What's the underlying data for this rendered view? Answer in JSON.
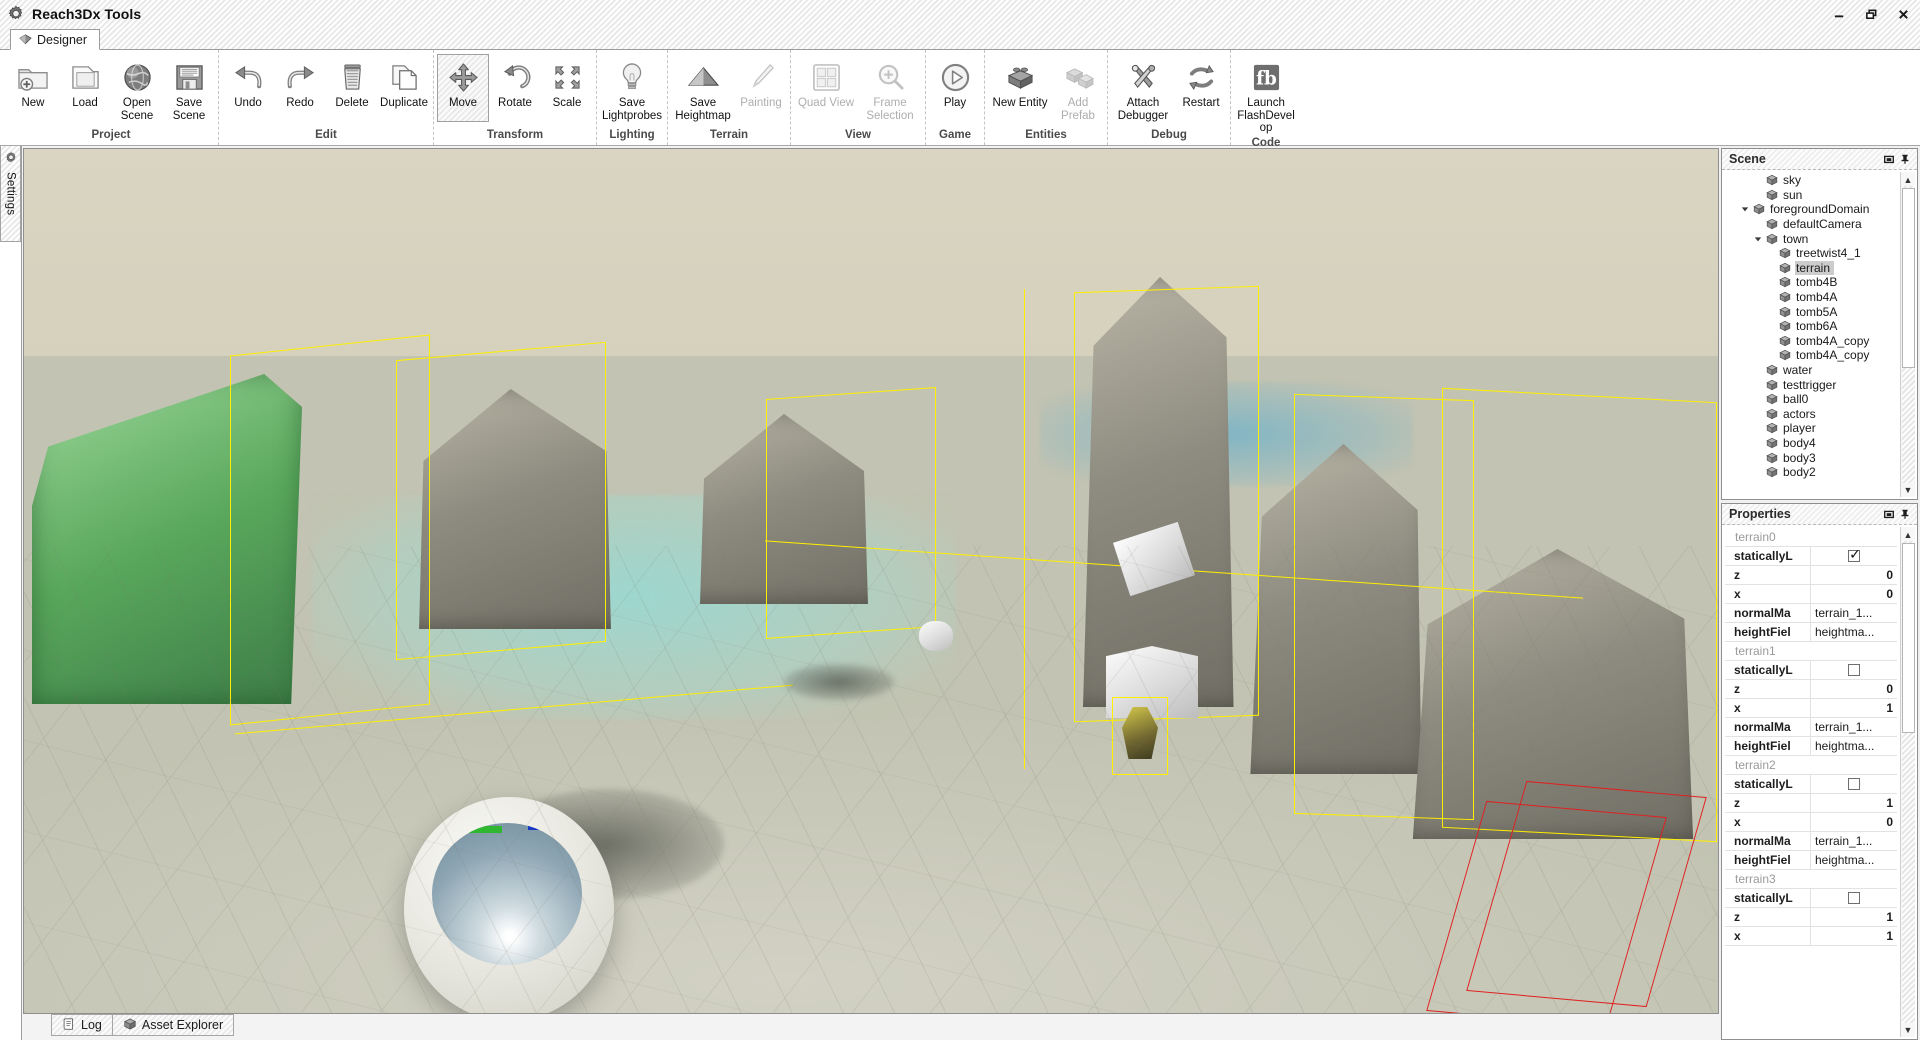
{
  "window": {
    "title": "Reach3Dx Tools",
    "app_icon": "gear-icon",
    "controls": {
      "minimize": "–",
      "restore": "❐",
      "close": "✕"
    }
  },
  "ribbon": {
    "tabs": [
      {
        "label": "Designer",
        "icon": "diamond-icon",
        "active": true
      }
    ],
    "groups": [
      {
        "label": "Project",
        "buttons": [
          {
            "label": "New",
            "icon": "new-folder-icon",
            "enabled": true,
            "active": false
          },
          {
            "label": "Load",
            "icon": "open-folder-icon",
            "enabled": true,
            "active": false
          },
          {
            "label": "Open Scene",
            "icon": "globe-icon",
            "enabled": true,
            "active": false
          },
          {
            "label": "Save Scene",
            "icon": "floppy-icon",
            "enabled": true,
            "active": false
          }
        ]
      },
      {
        "label": "Edit",
        "buttons": [
          {
            "label": "Undo",
            "icon": "undo-arrow-icon",
            "enabled": true,
            "active": false
          },
          {
            "label": "Redo",
            "icon": "redo-arrow-icon",
            "enabled": true,
            "active": false
          },
          {
            "label": "Delete",
            "icon": "trash-icon",
            "enabled": true,
            "active": false
          },
          {
            "label": "Duplicate",
            "icon": "copy-pages-icon",
            "enabled": true,
            "active": false
          }
        ]
      },
      {
        "label": "Transform",
        "buttons": [
          {
            "label": "Move",
            "icon": "move-cross-arrows-icon",
            "enabled": true,
            "active": true
          },
          {
            "label": "Rotate",
            "icon": "rotate-arrow-icon",
            "enabled": true,
            "active": false
          },
          {
            "label": "Scale",
            "icon": "scale-corners-icon",
            "enabled": true,
            "active": false
          }
        ]
      },
      {
        "label": "Lighting",
        "buttons": [
          {
            "label": "Save Lightprobes",
            "icon": "lightbulb-icon",
            "enabled": true,
            "active": false
          }
        ]
      },
      {
        "label": "Terrain",
        "buttons": [
          {
            "label": "Save Heightmap",
            "icon": "pyramid-icon",
            "enabled": true,
            "active": false
          },
          {
            "label": "Painting",
            "icon": "paintbrush-icon",
            "enabled": false,
            "active": false
          }
        ]
      },
      {
        "label": "View",
        "buttons": [
          {
            "label": "Quad View",
            "icon": "grid-four-panes-icon",
            "enabled": false,
            "active": false
          },
          {
            "label": "Frame Selection",
            "icon": "magnifier-plus-icon",
            "enabled": false,
            "active": false
          }
        ]
      },
      {
        "label": "Game",
        "buttons": [
          {
            "label": "Play",
            "icon": "play-circle-icon",
            "enabled": true,
            "active": false
          }
        ]
      },
      {
        "label": "Entities",
        "buttons": [
          {
            "label": "New Entity",
            "icon": "brick-block-icon",
            "enabled": true,
            "active": false
          },
          {
            "label": "Add Prefab",
            "icon": "brick-stack-icon",
            "enabled": false,
            "active": false
          }
        ]
      },
      {
        "label": "Debug",
        "buttons": [
          {
            "label": "Attach Debugger",
            "icon": "hammer-wrench-icon",
            "enabled": true,
            "active": false
          },
          {
            "label": "Restart",
            "icon": "refresh-cycle-icon",
            "enabled": true,
            "active": false
          }
        ]
      },
      {
        "label": "Code",
        "buttons": [
          {
            "label": "Launch FlashDevelop",
            "icon": "flashdevelop-fd-icon",
            "enabled": true,
            "active": false
          }
        ]
      }
    ]
  },
  "left_dock": {
    "tab": {
      "label": "Settings",
      "icon": "gear-icon"
    }
  },
  "scene_panel": {
    "title": "Scene",
    "float_button": "restore-icon",
    "pin_button": "pin-icon",
    "tree": [
      {
        "label": "sky",
        "depth": 2,
        "icon": "cube-icon",
        "twist": "",
        "selected": false
      },
      {
        "label": "sun",
        "depth": 2,
        "icon": "cube-icon",
        "twist": "",
        "selected": false
      },
      {
        "label": "foregroundDomain",
        "depth": 1,
        "icon": "cube-icon",
        "twist": "down",
        "selected": false
      },
      {
        "label": "defaultCamera",
        "depth": 2,
        "icon": "cube-icon",
        "twist": "",
        "selected": false
      },
      {
        "label": "town",
        "depth": 2,
        "icon": "cube-icon",
        "twist": "down",
        "selected": false
      },
      {
        "label": "treetwist4_1",
        "depth": 3,
        "icon": "cube-icon",
        "twist": "",
        "selected": false
      },
      {
        "label": "terrain",
        "depth": 3,
        "icon": "cube-icon",
        "twist": "",
        "selected": true
      },
      {
        "label": "tomb4B",
        "depth": 3,
        "icon": "cube-icon",
        "twist": "",
        "selected": false
      },
      {
        "label": "tomb4A",
        "depth": 3,
        "icon": "cube-icon",
        "twist": "",
        "selected": false
      },
      {
        "label": "tomb5A",
        "depth": 3,
        "icon": "cube-icon",
        "twist": "",
        "selected": false
      },
      {
        "label": "tomb6A",
        "depth": 3,
        "icon": "cube-icon",
        "twist": "",
        "selected": false
      },
      {
        "label": "tomb4A_copy",
        "depth": 3,
        "icon": "cube-icon",
        "twist": "",
        "selected": false
      },
      {
        "label": "tomb4A_copy",
        "depth": 3,
        "icon": "cube-icon",
        "twist": "",
        "selected": false
      },
      {
        "label": "water",
        "depth": 2,
        "icon": "cube-icon",
        "twist": "",
        "selected": false
      },
      {
        "label": "testtrigger",
        "depth": 2,
        "icon": "cube-icon",
        "twist": "",
        "selected": false
      },
      {
        "label": "ball0",
        "depth": 2,
        "icon": "cube-icon",
        "twist": "",
        "selected": false
      },
      {
        "label": "actors",
        "depth": 2,
        "icon": "cube-icon",
        "twist": "",
        "selected": false
      },
      {
        "label": "player",
        "depth": 2,
        "icon": "cube-icon",
        "twist": "",
        "selected": false
      },
      {
        "label": "body4",
        "depth": 2,
        "icon": "cube-icon",
        "twist": "",
        "selected": false
      },
      {
        "label": "body3",
        "depth": 2,
        "icon": "cube-icon",
        "twist": "",
        "selected": false
      },
      {
        "label": "body2",
        "depth": 2,
        "icon": "cube-icon",
        "twist": "",
        "selected": false
      }
    ]
  },
  "properties_panel": {
    "title": "Properties",
    "float_button": "restore-icon",
    "pin_button": "pin-icon",
    "rows": [
      {
        "type": "group",
        "name": "terrain0"
      },
      {
        "type": "bool",
        "key": "staticallyL",
        "value": true
      },
      {
        "type": "num",
        "key": "z",
        "value": "0"
      },
      {
        "type": "num",
        "key": "x",
        "value": "0"
      },
      {
        "type": "text",
        "key": "normalMa",
        "value": "terrain_1..."
      },
      {
        "type": "text",
        "key": "heightFiel",
        "value": "heightma..."
      },
      {
        "type": "group",
        "name": "terrain1"
      },
      {
        "type": "bool",
        "key": "staticallyL",
        "value": false
      },
      {
        "type": "num",
        "key": "z",
        "value": "0"
      },
      {
        "type": "num",
        "key": "x",
        "value": "1"
      },
      {
        "type": "text",
        "key": "normalMa",
        "value": "terrain_1..."
      },
      {
        "type": "text",
        "key": "heightFiel",
        "value": "heightma..."
      },
      {
        "type": "group",
        "name": "terrain2"
      },
      {
        "type": "bool",
        "key": "staticallyL",
        "value": false
      },
      {
        "type": "num",
        "key": "z",
        "value": "1"
      },
      {
        "type": "num",
        "key": "x",
        "value": "0"
      },
      {
        "type": "text",
        "key": "normalMa",
        "value": "terrain_1..."
      },
      {
        "type": "text",
        "key": "heightFiel",
        "value": "heightma..."
      },
      {
        "type": "group",
        "name": "terrain3"
      },
      {
        "type": "bool",
        "key": "staticallyL",
        "value": false
      },
      {
        "type": "num",
        "key": "z",
        "value": "1"
      },
      {
        "type": "num",
        "key": "x",
        "value": "1"
      }
    ]
  },
  "bottom_tabs": [
    {
      "label": "Log",
      "icon": "log-scroll-icon"
    },
    {
      "label": "Asset Explorer",
      "icon": "cube-icon"
    }
  ],
  "viewport": {
    "description": "3D scene: desert town with stone tombs, green-highlighted tomb, water, yellow selection bounding boxes, red trigger volume, reflective sphere",
    "colors": {
      "selection_box": "#ffef00",
      "trigger_box": "#e02020",
      "highlight_green": "#59a85d",
      "sand": "#cdc9b5",
      "water": "#7ab4c6"
    }
  }
}
